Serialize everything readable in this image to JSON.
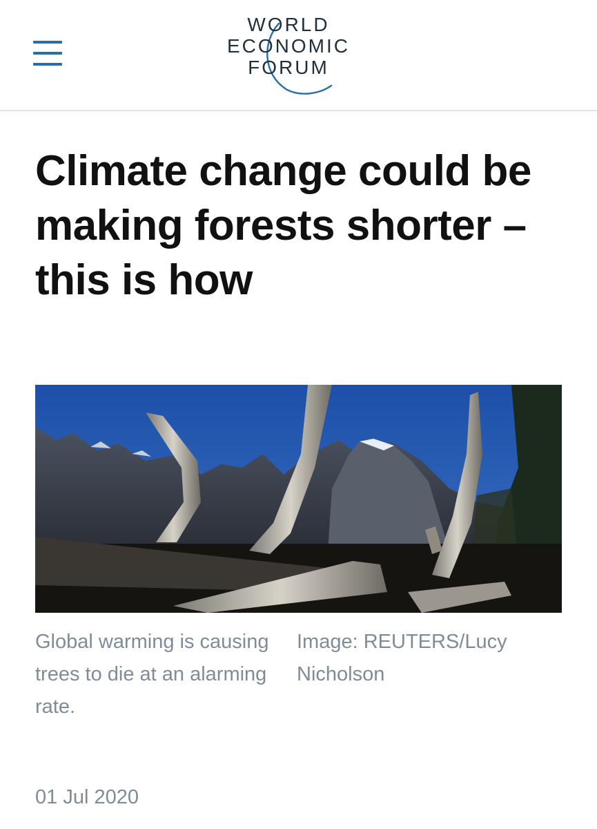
{
  "header": {
    "logo": {
      "line1": "WORLD",
      "line2": "ECONOMIC",
      "line3": "FORUM"
    },
    "menu_icon": "hamburger-menu-icon"
  },
  "article": {
    "title": "Climate change could be making forests shorter – this is how",
    "image_caption": "Global warming is causing trees to die at an alarming rate.",
    "image_credit": "Image: REUTERS/Lucy Nicholson",
    "date": "01 Jul 2020"
  },
  "colors": {
    "brand_blue": "#2a6ea6",
    "logo_text": "#1f2f3d",
    "muted_text": "#7f8c97",
    "divider": "#dde3ea"
  }
}
